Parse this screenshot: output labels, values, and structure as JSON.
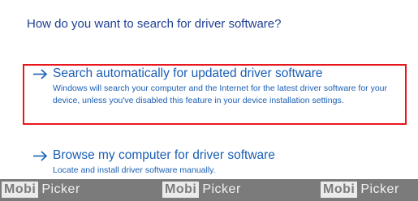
{
  "dialog": {
    "heading": "How do you want to search for driver software?",
    "options": [
      {
        "title": "Search automatically for updated driver software",
        "description": "Windows will search your computer and the Internet for the latest driver software for your device, unless you've disabled this feature in your device installation settings.",
        "icon": "arrow-right-icon",
        "highlighted": true
      },
      {
        "title": "Browse my computer for driver software",
        "description": "Locate and install driver software manually.",
        "icon": "arrow-right-icon",
        "highlighted": false
      }
    ]
  },
  "watermark": {
    "brand_logo": "Mobi",
    "brand_text": "Picker",
    "repeat_count": 3
  },
  "colors": {
    "link_blue": "#1a5fb4",
    "heading_blue": "#1e3f93",
    "highlight_red": "#e8171e",
    "watermark_band": "#7b7b7b"
  }
}
